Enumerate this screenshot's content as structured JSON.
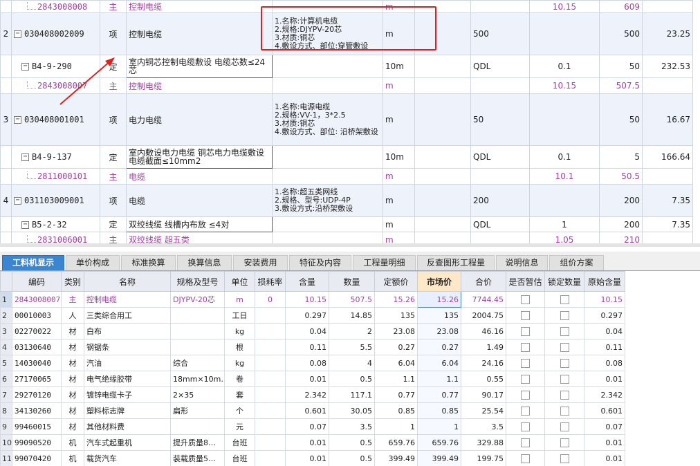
{
  "upper_rows": [
    {
      "type": "mat",
      "idx": "",
      "code": "2843008008",
      "cls": "主",
      "name": "控制电缆",
      "feature": "",
      "unit": "m",
      "qty_expr": "",
      "qty1": "",
      "qty2": "10.15",
      "qty3": "609",
      "price": ""
    },
    {
      "type": "main",
      "idx": "2",
      "code": "030408002009",
      "cls": "项",
      "name": "控制电缆",
      "feature": "1.名称:计算机电缆\n2.规格:DJYPV-20芯\n3.材质:铜芯\n4.敷设方式、部位:穿管敷设",
      "unit": "m",
      "qty_expr": "",
      "qty1": "500",
      "qty2": "",
      "qty3": "500",
      "price": "23.25"
    },
    {
      "type": "quota",
      "idx": "",
      "code": "B4-9-290",
      "cls": "定",
      "name": "室内铜芯控制电缆敷设 电缆芯数≤24芯",
      "feature": "",
      "unit": "10m",
      "qty_expr": "",
      "qty1": "QDL",
      "qty2": "0.1",
      "qty3": "50",
      "price": "232.53"
    },
    {
      "type": "mat",
      "idx": "",
      "code": "2843008007",
      "cls": "主",
      "name": "控制电缆",
      "feature": "",
      "unit": "m",
      "qty_expr": "",
      "qty1": "",
      "qty2": "10.15",
      "qty3": "507.5",
      "price": ""
    },
    {
      "type": "main",
      "idx": "3",
      "code": "030408001001",
      "cls": "项",
      "name": "电力电缆",
      "feature": "1.名称:电源电缆\n2.规格:VV-1，3*2.5\n3.材质:铜芯\n4.敷设方式、部位: 沿桥架敷设",
      "unit": "m",
      "qty_expr": "",
      "qty1": "50",
      "qty2": "",
      "qty3": "50",
      "price": "16.67"
    },
    {
      "type": "quota",
      "idx": "",
      "code": "B4-9-137",
      "cls": "定",
      "name": "室内敷设电力电缆 铜芯电力电缆敷设 电缆截面≤10mm2",
      "feature": "",
      "unit": "10m",
      "qty_expr": "",
      "qty1": "QDL",
      "qty2": "0.1",
      "qty3": "5",
      "price": "166.64"
    },
    {
      "type": "mat",
      "idx": "",
      "code": "2811000101",
      "cls": "主",
      "name": "电缆",
      "feature": "",
      "unit": "m",
      "qty_expr": "",
      "qty1": "",
      "qty2": "10.1",
      "qty3": "50.5",
      "price": ""
    },
    {
      "type": "main",
      "idx": "4",
      "code": "031103009001",
      "cls": "项",
      "name": "电缆",
      "feature": "1.名称:超五类网线\n2.规格、型号:UDP-4P\n3.敷设方式:沿桥架敷设",
      "unit": "m",
      "qty_expr": "",
      "qty1": "200",
      "qty2": "",
      "qty3": "200",
      "price": "7.35"
    },
    {
      "type": "quota",
      "idx": "",
      "code": "B5-2-32",
      "cls": "定",
      "name": "双绞线缆 线槽内布放 ≤4对",
      "feature": "",
      "unit": "m",
      "qty_expr": "",
      "qty1": "QDL",
      "qty2": "1",
      "qty3": "200",
      "price": "7.35"
    },
    {
      "type": "mat",
      "idx": "",
      "code": "2831006001",
      "cls": "主",
      "name": "双绞线缆  超五类",
      "feature": "",
      "unit": "m",
      "qty_expr": "",
      "qty1": "",
      "qty2": "1.05",
      "qty3": "210",
      "price": ""
    },
    {
      "type": "main",
      "idx": "",
      "code": "",
      "cls": "",
      "name": "",
      "feature": "1.名称:电源电缆",
      "unit": "",
      "qty_expr": "",
      "qty1": "",
      "qty2": "",
      "qty3": "",
      "price": ""
    }
  ],
  "tabs": [
    "工料机显示",
    "单价构成",
    "标准换算",
    "换算信息",
    "安装费用",
    "特征及内容",
    "工程量明细",
    "反查图形工程量",
    "说明信息",
    "组价方案"
  ],
  "lower_headers": [
    "",
    "编码",
    "类别",
    "名称",
    "规格及型号",
    "单位",
    "损耗率",
    "含量",
    "数量",
    "定额价",
    "市场价",
    "合价",
    "是否暂估",
    "锁定数量",
    "原始含量"
  ],
  "lower_rows": [
    {
      "n": "1",
      "code": "2843008007",
      "cls": "主",
      "name": "控制电缆",
      "spec": "DJYPV-20芯",
      "unit": "m",
      "loss": "0",
      "content": "10.15",
      "qty": "507.5",
      "quota_price": "15.26",
      "market_price": "15.26",
      "total": "7744.45",
      "orig": "10.15"
    },
    {
      "n": "2",
      "code": "00010003",
      "cls": "人",
      "name": "三类综合用工",
      "spec": "",
      "unit": "工日",
      "loss": "",
      "content": "0.297",
      "qty": "14.85",
      "quota_price": "135",
      "market_price": "135",
      "total": "2004.75",
      "orig": "0.297"
    },
    {
      "n": "3",
      "code": "02270022",
      "cls": "材",
      "name": "白布",
      "spec": "",
      "unit": "kg",
      "loss": "",
      "content": "0.04",
      "qty": "2",
      "quota_price": "23.08",
      "market_price": "23.08",
      "total": "46.16",
      "orig": "0.04"
    },
    {
      "n": "4",
      "code": "03130640",
      "cls": "材",
      "name": "钢锯条",
      "spec": "",
      "unit": "根",
      "loss": "",
      "content": "0.11",
      "qty": "5.5",
      "quota_price": "0.27",
      "market_price": "0.27",
      "total": "1.49",
      "orig": "0.11"
    },
    {
      "n": "5",
      "code": "14030040",
      "cls": "材",
      "name": "汽油",
      "spec": "综合",
      "unit": "kg",
      "loss": "",
      "content": "0.08",
      "qty": "4",
      "quota_price": "6.04",
      "market_price": "6.04",
      "total": "24.16",
      "orig": "0.08"
    },
    {
      "n": "6",
      "code": "27170065",
      "cls": "材",
      "name": "电气绝缘胶带",
      "spec": "18mm×10m…",
      "unit": "卷",
      "loss": "",
      "content": "0.01",
      "qty": "0.5",
      "quota_price": "1.1",
      "market_price": "1.1",
      "total": "0.55",
      "orig": "0.01"
    },
    {
      "n": "7",
      "code": "29270120",
      "cls": "材",
      "name": "镀锌电缆卡子",
      "spec": "2×35",
      "unit": "套",
      "loss": "",
      "content": "2.342",
      "qty": "117.1",
      "quota_price": "0.77",
      "market_price": "0.77",
      "total": "90.17",
      "orig": "2.342"
    },
    {
      "n": "8",
      "code": "34130260",
      "cls": "材",
      "name": "塑料标志牌",
      "spec": "扁形",
      "unit": "个",
      "loss": "",
      "content": "0.601",
      "qty": "30.05",
      "quota_price": "0.85",
      "market_price": "0.85",
      "total": "25.54",
      "orig": "0.601"
    },
    {
      "n": "9",
      "code": "99460015",
      "cls": "材",
      "name": "其他材料费",
      "spec": "",
      "unit": "元",
      "loss": "",
      "content": "0.07",
      "qty": "3.5",
      "quota_price": "1",
      "market_price": "1",
      "total": "3.5",
      "orig": "0.07"
    },
    {
      "n": "10",
      "code": "99090520",
      "cls": "机",
      "name": "汽车式起重机",
      "spec": "提升质量8…",
      "unit": "台班",
      "loss": "",
      "content": "0.01",
      "qty": "0.5",
      "quota_price": "659.76",
      "market_price": "659.76",
      "total": "329.88",
      "orig": "0.01"
    },
    {
      "n": "11",
      "code": "99070420",
      "cls": "机",
      "name": "载货汽车",
      "spec": "装载质量5…",
      "unit": "台班",
      "loss": "",
      "content": "0.01",
      "qty": "0.5",
      "quota_price": "399.49",
      "market_price": "399.49",
      "total": "199.75",
      "orig": "0.01"
    }
  ],
  "colors": {
    "accent": "#3c85d1",
    "material_text": "#a040a0",
    "highlight": "#e02020",
    "main_row_bg": "#eef2fa"
  }
}
